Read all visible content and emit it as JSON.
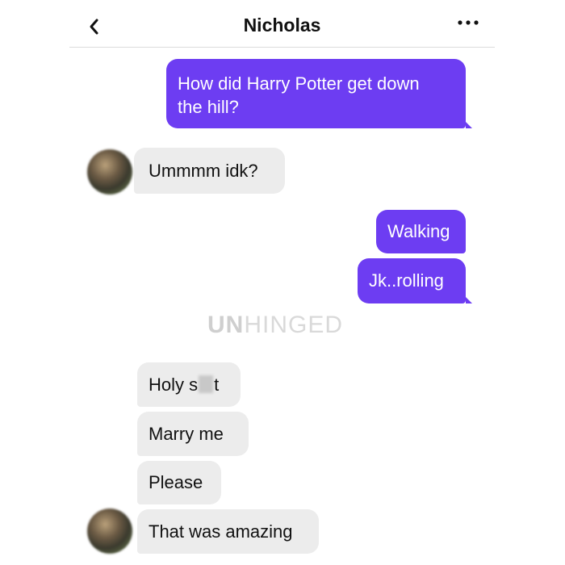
{
  "header": {
    "title": "Nicholas",
    "back_icon": "chevron-left-icon",
    "more_icon": "more-horizontal-icon"
  },
  "colors": {
    "outgoing_bubble": "#6d3df2",
    "incoming_bubble": "#ececec"
  },
  "messages": [
    {
      "direction": "outgoing",
      "line1": "How did Harry Potter get down",
      "line2": "the hill?"
    },
    {
      "direction": "incoming",
      "text": "Ummmm idk?"
    },
    {
      "direction": "outgoing",
      "text": "Walking"
    },
    {
      "direction": "outgoing",
      "text": "Jk..rolling"
    },
    {
      "direction": "incoming",
      "pre": "Holy s",
      "post": "t"
    },
    {
      "direction": "incoming",
      "text": "Marry me"
    },
    {
      "direction": "incoming",
      "text": "Please"
    },
    {
      "direction": "incoming",
      "text": "That was amazing"
    }
  ],
  "watermark": {
    "bold": "UN",
    "rest": "HINGED"
  }
}
